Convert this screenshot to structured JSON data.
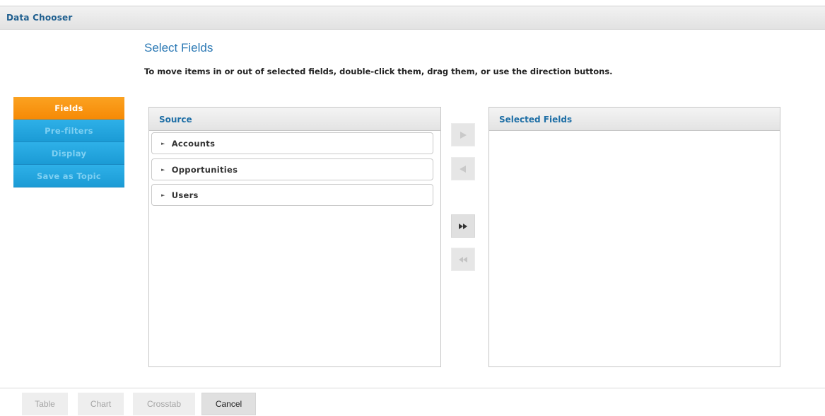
{
  "window": {
    "title": "Data Chooser"
  },
  "page": {
    "title": "Select Fields",
    "instructions": "To move items in or out of selected fields, double-click them, drag them, or use the direction buttons."
  },
  "nav": {
    "items": [
      {
        "label": "Fields",
        "state": "active"
      },
      {
        "label": "Pre-filters",
        "state": "inactive"
      },
      {
        "label": "Display",
        "state": "inactive"
      },
      {
        "label": "Save as Topic",
        "state": "inactive"
      }
    ]
  },
  "source": {
    "header": "Source",
    "items": [
      {
        "label": "Accounts"
      },
      {
        "label": "Opportunities"
      },
      {
        "label": "Users"
      }
    ]
  },
  "selected": {
    "header": "Selected Fields",
    "items": []
  },
  "direction_buttons": {
    "add": {
      "icon": "triangle-right-icon",
      "enabled": false
    },
    "remove": {
      "icon": "triangle-left-icon",
      "enabled": false
    },
    "add_all": {
      "icon": "double-right-icon",
      "enabled": true
    },
    "remove_all": {
      "icon": "double-left-icon",
      "enabled": false
    }
  },
  "footer": {
    "table_label": "Table",
    "chart_label": "Chart",
    "crosstab_label": "Crosstab",
    "cancel_label": "Cancel"
  },
  "colors": {
    "accent_orange": "#f68a06",
    "accent_blue": "#1b9bd5",
    "header_text": "#1f6fa6",
    "title_text": "#2a78b4"
  }
}
